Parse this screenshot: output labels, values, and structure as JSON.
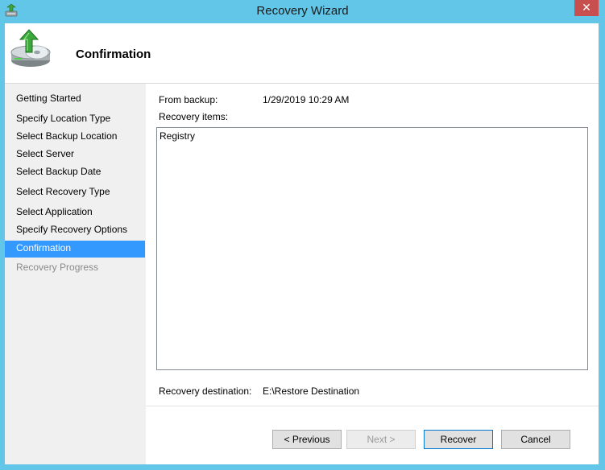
{
  "window": {
    "title": "Recovery Wizard",
    "close_glyph": "✕"
  },
  "header": {
    "title": "Confirmation",
    "icon": "backup-disk-icon"
  },
  "nav": {
    "items": [
      {
        "label": "Getting Started",
        "state": "normal"
      },
      {
        "label": "Specify Location Type",
        "state": "normal"
      },
      {
        "label": "Select Backup Location",
        "state": "normal"
      },
      {
        "label": "Select Server",
        "state": "normal"
      },
      {
        "label": "Select Backup Date",
        "state": "normal"
      },
      {
        "label": "Select Recovery Type",
        "state": "normal"
      },
      {
        "label": "Select Application",
        "state": "normal"
      },
      {
        "label": "Specify Recovery Options",
        "state": "normal"
      },
      {
        "label": "Confirmation",
        "state": "active"
      },
      {
        "label": "Recovery Progress",
        "state": "disabled"
      }
    ]
  },
  "details": {
    "from_backup_label": "From backup:",
    "from_backup_value": "1/29/2019 10:29 AM",
    "recovery_items_label": "Recovery items:",
    "recovery_items": [
      "Registry"
    ],
    "destination_label": "Recovery destination:",
    "destination_value": "E:\\Restore Destination"
  },
  "buttons": {
    "previous": "< Previous",
    "next": "Next >",
    "recover": "Recover",
    "cancel": "Cancel"
  },
  "colors": {
    "title_bar": "#62c6e8",
    "selection": "#3399ff",
    "close": "#c7504f"
  }
}
